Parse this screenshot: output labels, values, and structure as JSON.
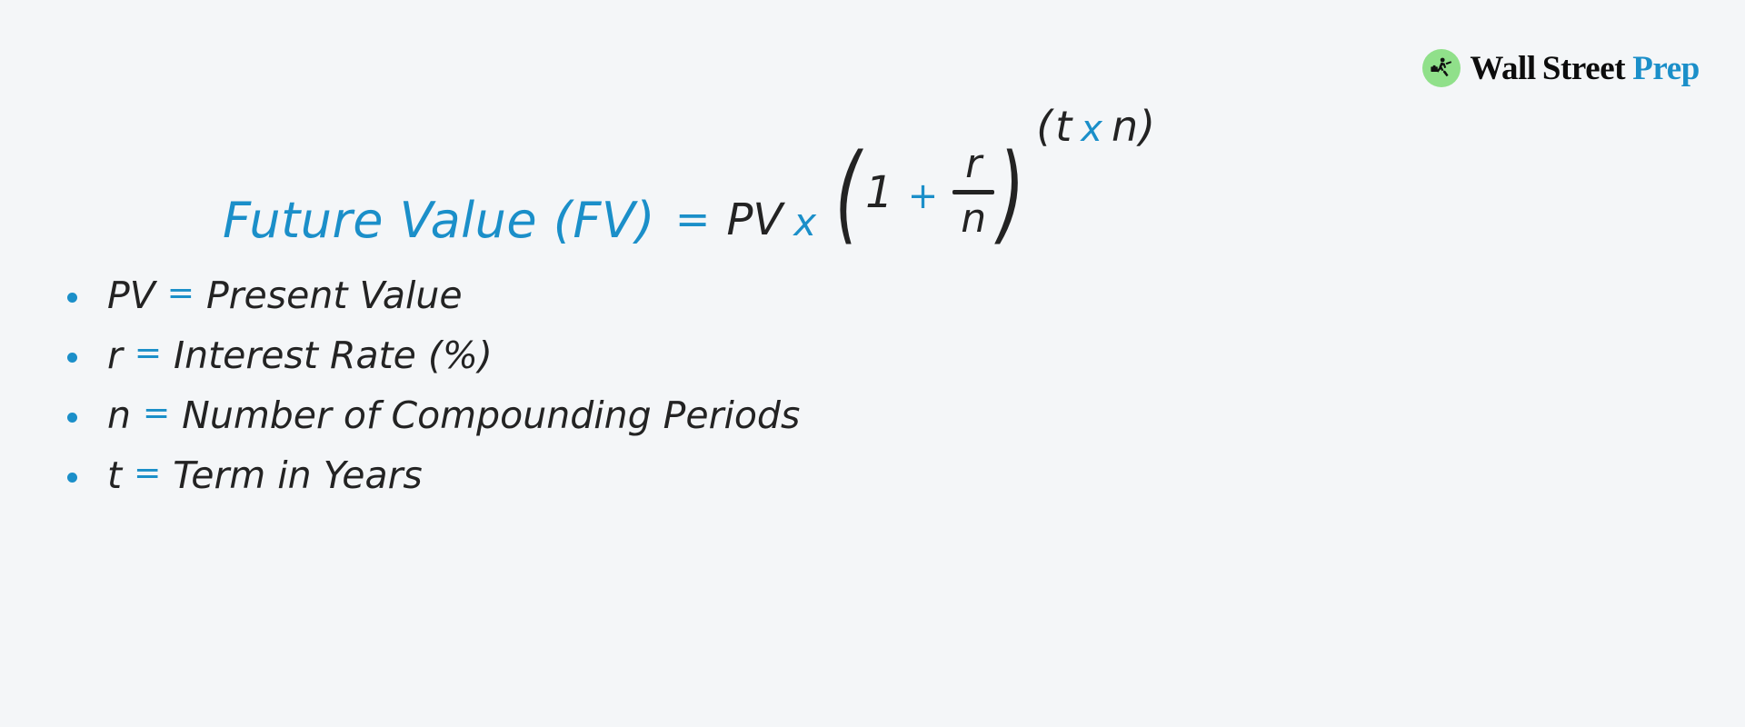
{
  "page": {
    "background_color": "#f4f6f8",
    "accent_color": "#1b8fc9",
    "text_color": "#232323"
  },
  "brand": {
    "logo_icon": "running-businessman-icon",
    "logo_circle_color": "#90e08a",
    "word_1": "Wall",
    "word_2": "Street",
    "word_3": "Prep"
  },
  "equation": {
    "left_side": "Future Value (FV)",
    "equals": "=",
    "pv": "PV",
    "times": "x",
    "open_paren": "(",
    "one": "1",
    "plus": "+",
    "numerator": "r",
    "denominator": "n",
    "close_paren": ")",
    "exponent": {
      "open_paren": "(",
      "t": "t",
      "times": "x",
      "n": "n",
      "close_paren": ")"
    }
  },
  "definitions": [
    {
      "symbol": "PV",
      "equals": "=",
      "text": "Present Value"
    },
    {
      "symbol": "r",
      "equals": "=",
      "text": "Interest Rate (%)"
    },
    {
      "symbol": "n",
      "equals": "=",
      "text": "Number of Compounding Periods"
    },
    {
      "symbol": "t",
      "equals": "=",
      "text": "Term in Years"
    }
  ]
}
